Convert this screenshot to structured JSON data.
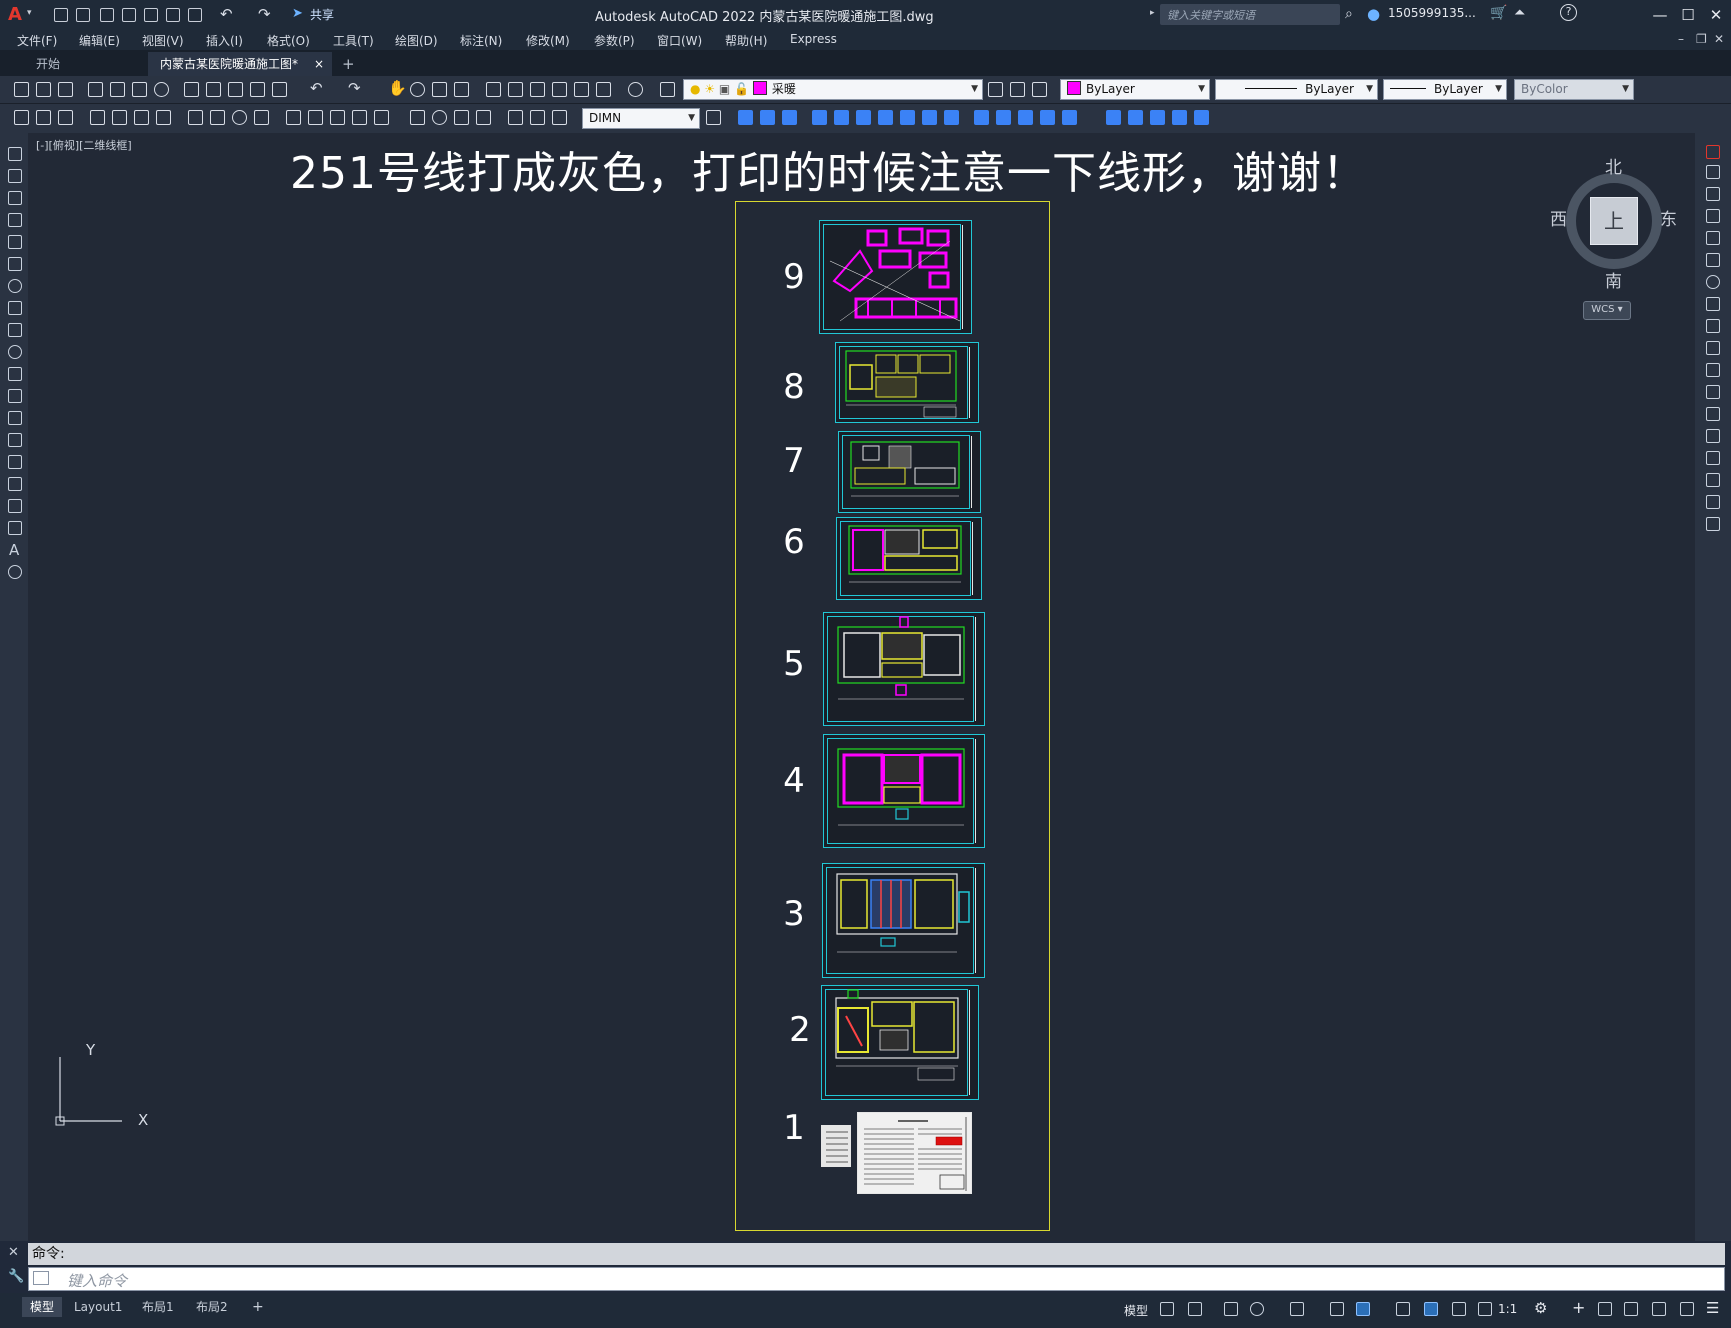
{
  "titlebar": {
    "title": "Autodesk AutoCAD 2022    内蒙古某医院暖通施工图.dwg",
    "share_label": "共享",
    "search_placeholder": "键入关键字或短语",
    "user_label": "1505999135..."
  },
  "menus": [
    "文件(F)",
    "编辑(E)",
    "视图(V)",
    "插入(I)",
    "格式(O)",
    "工具(T)",
    "绘图(D)",
    "标注(N)",
    "修改(M)",
    "参数(P)",
    "窗口(W)",
    "帮助(H)",
    "Express"
  ],
  "tabs": {
    "start": "开始",
    "active": "内蒙古某医院暖通施工图*",
    "close": "×",
    "new": "+"
  },
  "properties": {
    "layer": "采暖",
    "color": "ByLayer",
    "linetype": "ByLayer",
    "lineweight": "ByLayer",
    "plotstyle": "ByColor",
    "dimstyle": "DIMN",
    "layer_color": "#ff00ff"
  },
  "canvas": {
    "view_label": "[-][俯视][二维线框]",
    "note_text": "251号线打成灰色，打印的时候注意一下线形，谢谢！",
    "sheet_numbers": [
      "9",
      "8",
      "7",
      "6",
      "5",
      "4",
      "3",
      "2",
      "1"
    ]
  },
  "viewcube": {
    "north": "北",
    "south": "南",
    "east": "东",
    "west": "西",
    "face": "上",
    "wcs": "WCS"
  },
  "ucs": {
    "x": "X",
    "y": "Y"
  },
  "command": {
    "history": "命令:",
    "placeholder": "键入命令"
  },
  "status": {
    "layout_tabs": [
      "模型",
      "Layout1",
      "布局1",
      "布局2"
    ],
    "add_tab": "+",
    "model_label": "模型",
    "scale": "1:1"
  },
  "colors": {
    "background": "#222936",
    "frame": "#d8d830",
    "sheet_border": "#21c7d6",
    "hvac_magenta": "#ff00ff",
    "plan_yellow": "#e8e832",
    "plan_green": "#22dd22"
  }
}
